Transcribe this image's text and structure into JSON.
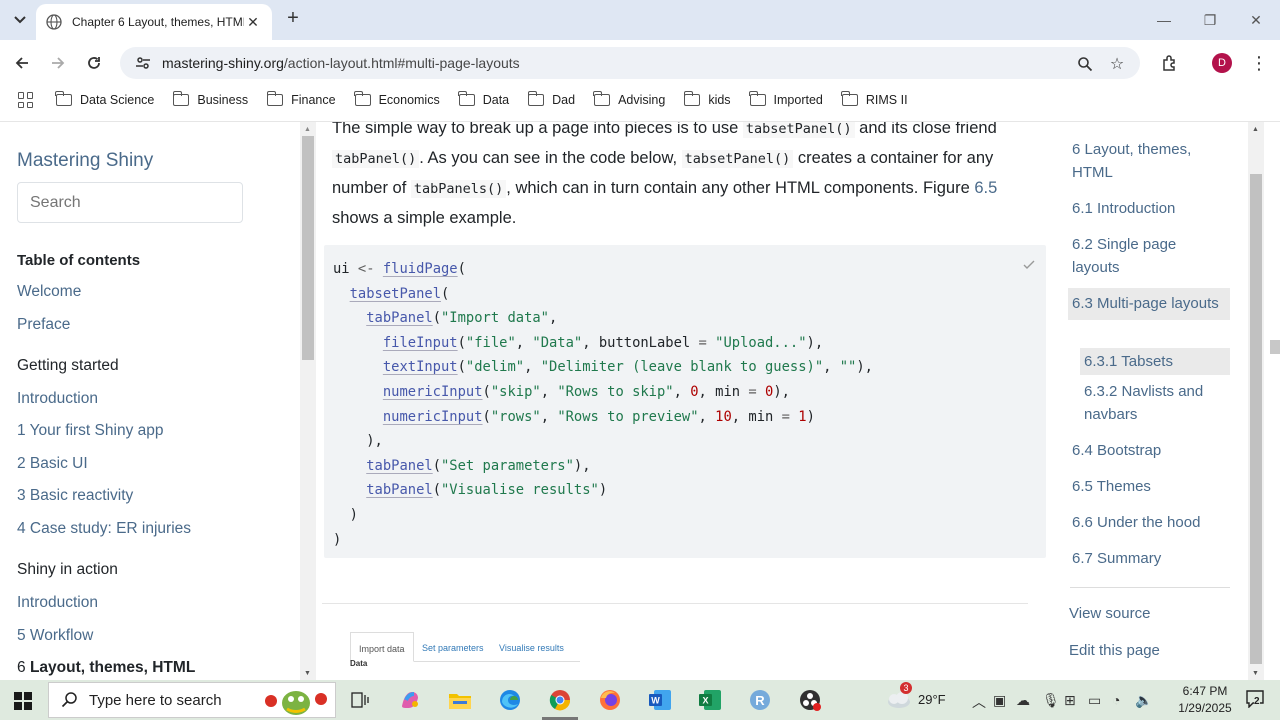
{
  "browser": {
    "tab_title": "Chapter 6 Layout, themes, HTML",
    "url_host": "mastering-shiny.org",
    "url_path": "/action-layout.html#multi-page-layouts",
    "avatar_letter": "D",
    "bookmarks": [
      "Data Science",
      "Business",
      "Finance",
      "Economics",
      "Data",
      "Dad",
      "Advising",
      "kids",
      "Imported",
      "RIMS II"
    ]
  },
  "sidebar": {
    "brand": "Mastering Shiny",
    "search_placeholder": "Search",
    "toc_heading": "Table of contents",
    "items": [
      {
        "label": "Welcome",
        "type": "item"
      },
      {
        "label": "Preface",
        "type": "item"
      },
      {
        "label": "Getting started",
        "type": "part"
      },
      {
        "label": "Introduction",
        "type": "item"
      },
      {
        "label": "1 Your first Shiny app",
        "type": "item"
      },
      {
        "label": "2 Basic UI",
        "type": "item"
      },
      {
        "label": "3 Basic reactivity",
        "type": "item"
      },
      {
        "label": "4 Case study: ER injuries",
        "type": "item"
      },
      {
        "label": "Shiny in action",
        "type": "part"
      },
      {
        "label": "Introduction",
        "type": "item"
      },
      {
        "label": "5 Workflow",
        "type": "item"
      }
    ],
    "active_number": "6",
    "active_title": "Layout, themes, HTML"
  },
  "main": {
    "p1": "The simple way to break up a page into pieces is to use",
    "c1": "tabsetPanel()",
    "p2": "and its close friend",
    "c2": "tabPanel()",
    "p3": ". As you can see in the code below,",
    "c3": "tabsetPanel()",
    "p4": "creates a container for any number of",
    "c4": "tabPanels()",
    "p5": ", which can in turn contain any other HTML components. Figure",
    "fig_link": "6.5",
    "p6": "shows a simple example.",
    "preview_tabs": [
      "Import data",
      "Set parameters",
      "Visualise results"
    ],
    "preview_label": "Data"
  },
  "right_toc": {
    "items": [
      {
        "label": "6 Layout, themes, HTML"
      },
      {
        "label": "6.1 Introduction"
      },
      {
        "label": "6.2 Single page layouts"
      },
      {
        "label": "6.3 Multi-page layouts"
      },
      {
        "label": "6.3.1 Tabsets"
      },
      {
        "label": "6.3.2 Navlists and navbars"
      },
      {
        "label": "6.4 Bootstrap"
      },
      {
        "label": "6.5 Themes"
      },
      {
        "label": "6.6 Under the hood"
      },
      {
        "label": "6.7 Summary"
      }
    ],
    "view_source": "View source",
    "edit_page": "Edit this page"
  },
  "taskbar": {
    "search_placeholder": "Type here to search",
    "weather_badge": "3",
    "temperature": "29°F",
    "time": "6:47 PM",
    "date": "1/29/2025",
    "notifications": "2"
  }
}
